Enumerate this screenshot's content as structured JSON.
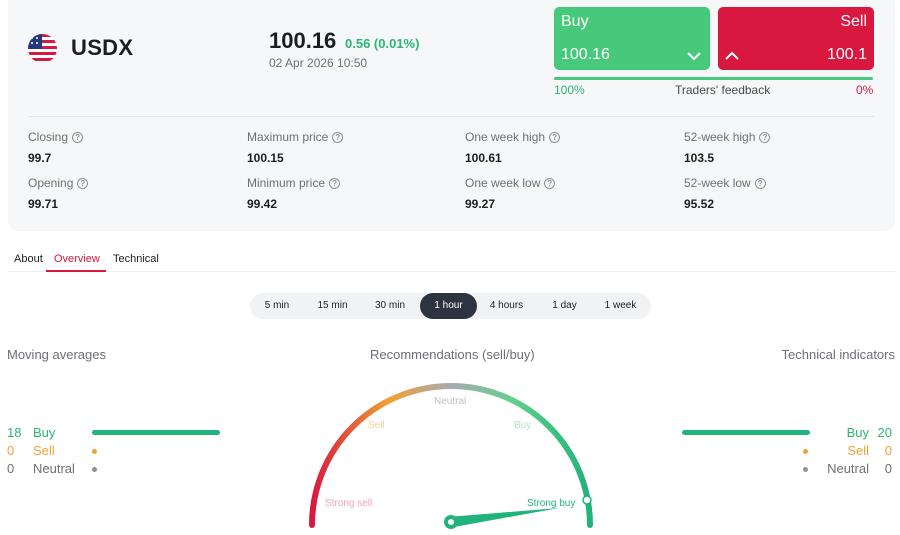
{
  "instrument": {
    "symbol": "USDX",
    "price": "100.16",
    "change": "0.56 (0.01%)",
    "datetime": "02 Apr 2026 10:50",
    "flag_icon": "us-flag-icon"
  },
  "trade": {
    "buy_label": "Buy",
    "buy_price": "100.16",
    "sell_label": "Sell",
    "sell_price": "100.1",
    "buy_icon": "chevron-down-icon",
    "sell_icon": "chevron-up-icon"
  },
  "feedback": {
    "buy_pct_text": "100%",
    "label": "Traders' feedback",
    "sell_pct_text": "0%",
    "buy_fraction": 1.0
  },
  "stats": {
    "closing_label": "Closing",
    "closing_value": "99.7",
    "max_label": "Maximum price",
    "max_value": "100.15",
    "week_high_label": "One week high",
    "week_high_value": "100.61",
    "year_high_label": "52-week high",
    "year_high_value": "103.5",
    "opening_label": "Opening",
    "opening_value": "99.71",
    "min_label": "Minimum price",
    "min_value": "99.42",
    "week_low_label": "One week low",
    "week_low_value": "99.27",
    "year_low_label": "52-week low",
    "year_low_value": "95.52"
  },
  "tabs": [
    "About",
    "Overview",
    "Technical"
  ],
  "periods": [
    "5 min",
    "15 min",
    "30 min",
    "1 hour",
    "4 hours",
    "1 day",
    "1 week"
  ],
  "active_period": "1 hour",
  "moving_averages": {
    "title": "Moving averages",
    "buy_count": "18",
    "buy_label": "Buy",
    "sell_count": "0",
    "sell_label": "Sell",
    "neutral_count": "0",
    "neutral_label": "Neutral"
  },
  "technical": {
    "title": "Technical indicators",
    "buy_count": "20",
    "buy_label": "Buy",
    "sell_count": "0",
    "sell_label": "Sell",
    "neutral_count": "0",
    "neutral_label": "Neutral"
  },
  "gauge": {
    "title": "Recommendations (sell/buy)",
    "strong_sell": "Strong sell",
    "sell": "Sell",
    "neutral": "Neutral",
    "buy": "Buy",
    "strong_buy": "Strong buy"
  },
  "colors": {
    "buy": "#47c97b",
    "sell": "#d8183f",
    "accent": "#d8183f",
    "indicator_buy": "#20b37b",
    "indicator_sell": "#f0a135",
    "indicator_neutral": "#8d9198"
  }
}
